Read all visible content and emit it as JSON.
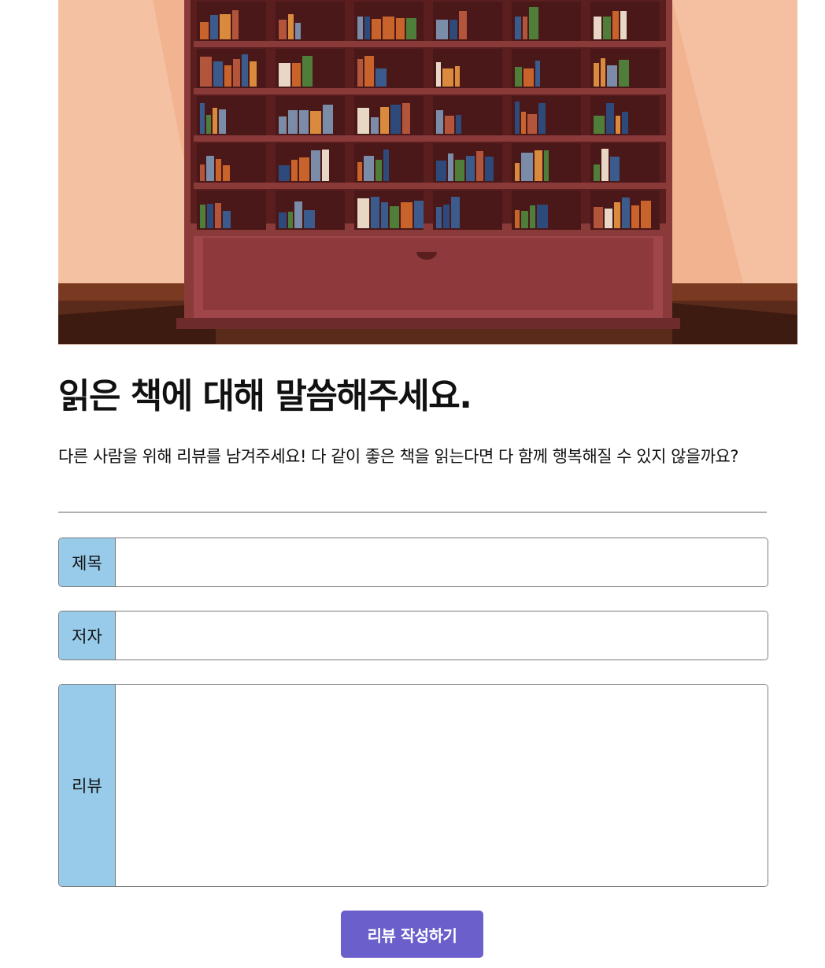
{
  "hero": {
    "alt": "bookshelf-illustration"
  },
  "heading": "읽은 책에 대해 말씀해주세요.",
  "description": "다른 사람을 위해 리뷰를 남겨주세요! 다 같이 좋은 책을 읽는다면 다 함께 행복해질 수 있지 않을까요?",
  "form": {
    "title_label": "제목",
    "title_value": "",
    "author_label": "저자",
    "author_value": "",
    "review_label": "리뷰",
    "review_value": "",
    "submit_label": "리뷰 작성하기"
  },
  "colors": {
    "label_bg": "#97cbe9",
    "submit_bg": "#6a5fcb",
    "wall": "#f2b391",
    "shelf": "#8b3a3a"
  }
}
